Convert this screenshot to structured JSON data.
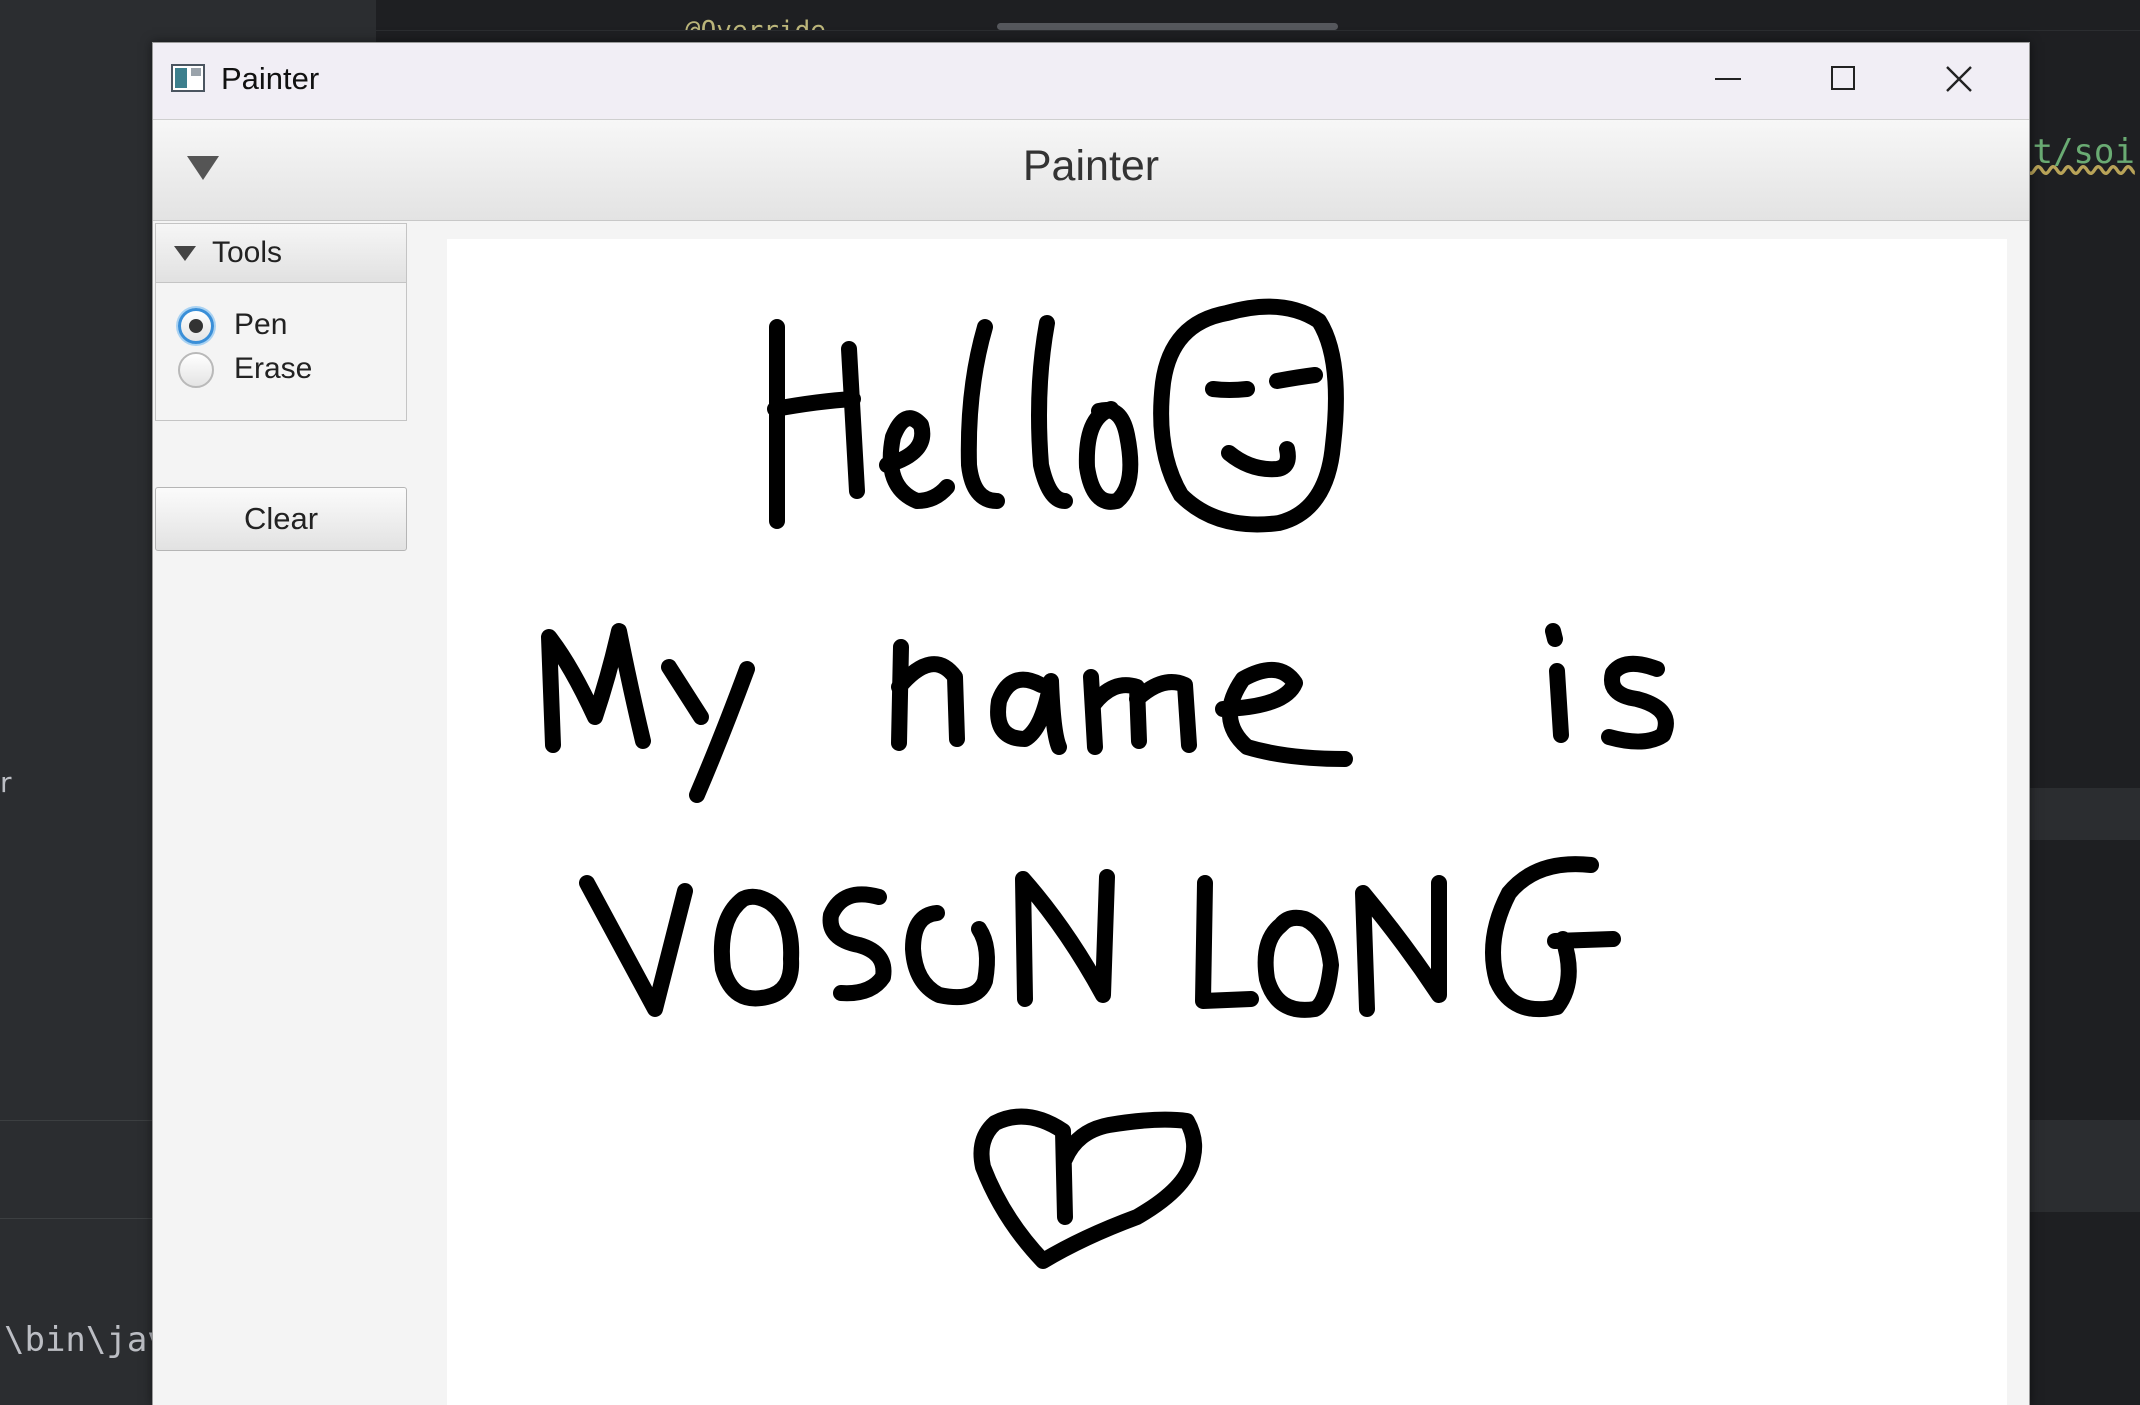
{
  "background_ide": {
    "code_top": "@Override",
    "code_right": "st/soi",
    "left_fragment": "r",
    "terminal_text": "\\bin\\jav"
  },
  "window": {
    "title": "Painter",
    "controls": {
      "minimize": "minimize",
      "maximize": "maximize",
      "close": "close"
    }
  },
  "header": {
    "title": "Painter",
    "menu_icon": "triangle-down-icon"
  },
  "tools": {
    "title": "Tools",
    "options": [
      {
        "label": "Pen",
        "selected": true
      },
      {
        "label": "Erase",
        "selected": false
      }
    ]
  },
  "clear_button": {
    "label": "Clear"
  },
  "canvas": {
    "drawing_text": "Hello My name is VOSON LONG",
    "stroke_color": "#000000",
    "background_color": "#ffffff"
  },
  "colors": {
    "accent": "#3a8fd8",
    "window_bg": "#f4f4f4",
    "titlebar_bg": "#f1eef5"
  }
}
